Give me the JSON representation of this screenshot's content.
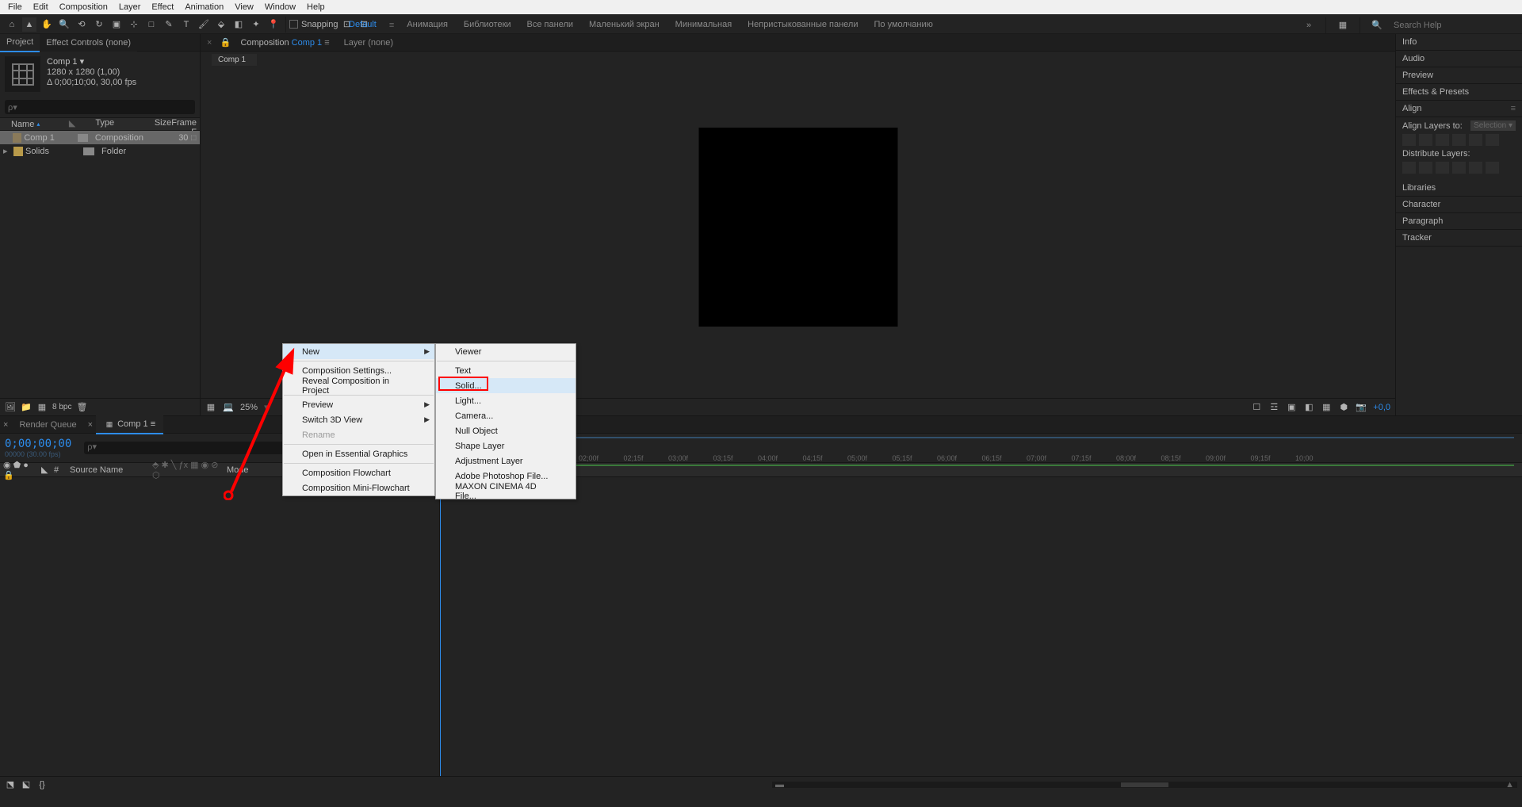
{
  "os_menu": [
    "File",
    "Edit",
    "Composition",
    "Layer",
    "Effect",
    "Animation",
    "View",
    "Window",
    "Help"
  ],
  "toolbar": {
    "snapping": "Snapping",
    "workspaces": [
      "Default",
      "Анимация",
      "Библиотеки",
      "Все панели",
      "Маленький экран",
      "Минимальная",
      "Непристыкованные панели",
      "По умолчанию"
    ],
    "search_ph": "Search Help"
  },
  "project": {
    "tab_project": "Project",
    "tab_effect": "Effect Controls (none)",
    "comp_name": "Comp 1 ▾",
    "comp_res": "1280 x 1280 (1,00)",
    "comp_dur": "Δ 0;00;10;00, 30,00 fps",
    "cols": {
      "name": "Name",
      "type": "Type",
      "size": "Size",
      "fr": "Frame F"
    },
    "rows": [
      {
        "name": "Comp 1",
        "type": "Composition",
        "size": "",
        "fr": "30",
        "sel": true,
        "folder": false
      },
      {
        "name": "Solids",
        "type": "Folder",
        "size": "",
        "fr": "",
        "sel": false,
        "folder": true
      }
    ],
    "footer_bpc": "8 bpc"
  },
  "viewer": {
    "tab_comp_prefix": "Composition",
    "tab_comp_name": "Comp 1",
    "tab_layer": "Layer (none)",
    "subtab": "Comp 1",
    "zoom": "25%",
    "exposure": "+0,0"
  },
  "right_panels": [
    "Info",
    "Audio",
    "Preview",
    "Effects & Presets",
    "Align",
    "Libraries",
    "Character",
    "Paragraph",
    "Tracker"
  ],
  "align": {
    "label": "Align Layers to:",
    "sel": "Selection",
    "dist": "Distribute Layers:"
  },
  "timeline": {
    "tab_rq": "Render Queue",
    "tab_comp": "Comp 1",
    "timecode": "0;00;00;00",
    "timecode_sub": "00000 (30.00 fps)",
    "cols": {
      "num": "#",
      "source": "Source Name",
      "mode": "Mode"
    },
    "ruler": [
      "02;00f",
      "02;15f",
      "03;00f",
      "03;15f",
      "04;00f",
      "04;15f",
      "05;00f",
      "05;15f",
      "06;00f",
      "06;15f",
      "07;00f",
      "07;15f",
      "08;00f",
      "08;15f",
      "09;00f",
      "09;15f",
      "10;00"
    ]
  },
  "ctx1": [
    {
      "t": "New",
      "arrow": true,
      "hover": true
    },
    {
      "sep": true
    },
    {
      "t": "Composition Settings..."
    },
    {
      "t": "Reveal Composition in Project"
    },
    {
      "sep": true
    },
    {
      "t": "Preview",
      "arrow": true
    },
    {
      "t": "Switch 3D View",
      "arrow": true
    },
    {
      "t": "Rename",
      "dis": true
    },
    {
      "sep": true
    },
    {
      "t": "Open in Essential Graphics"
    },
    {
      "sep": true
    },
    {
      "t": "Composition Flowchart"
    },
    {
      "t": "Composition Mini-Flowchart"
    }
  ],
  "ctx2": [
    {
      "t": "Viewer"
    },
    {
      "sep": true
    },
    {
      "t": "Text"
    },
    {
      "t": "Solid...",
      "hover": true
    },
    {
      "t": "Light..."
    },
    {
      "t": "Camera..."
    },
    {
      "t": "Null Object"
    },
    {
      "t": "Shape Layer"
    },
    {
      "t": "Adjustment Layer"
    },
    {
      "t": "Adobe Photoshop File..."
    },
    {
      "t": "MAXON CINEMA 4D File..."
    }
  ]
}
